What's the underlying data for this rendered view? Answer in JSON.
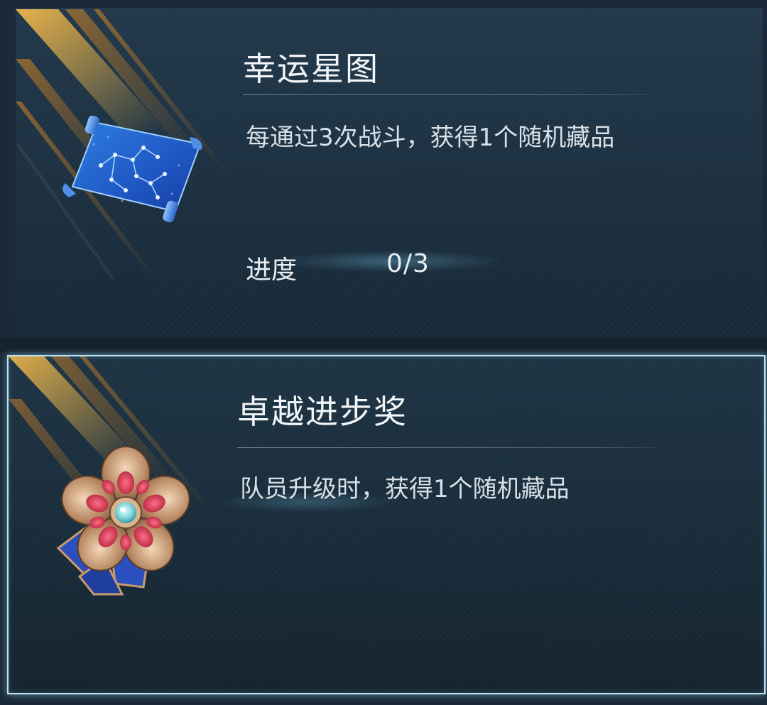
{
  "cards": [
    {
      "title": "幸运星图",
      "description": "每通过3次战斗，获得1个随机藏品",
      "icon": "star-chart-scroll-icon",
      "progress": {
        "label": "进度",
        "value": "0/3",
        "current": 0,
        "total": 3
      }
    },
    {
      "title": "卓越进步奖",
      "description": "队员升级时，获得1个随机藏品",
      "icon": "flower-medal-icon",
      "selected": true
    }
  ],
  "colors": {
    "card_background": "#1c3040",
    "selected_border": "#bfe3f3",
    "gold_streak": "#e0a63a",
    "text": "#f2f5f7"
  }
}
